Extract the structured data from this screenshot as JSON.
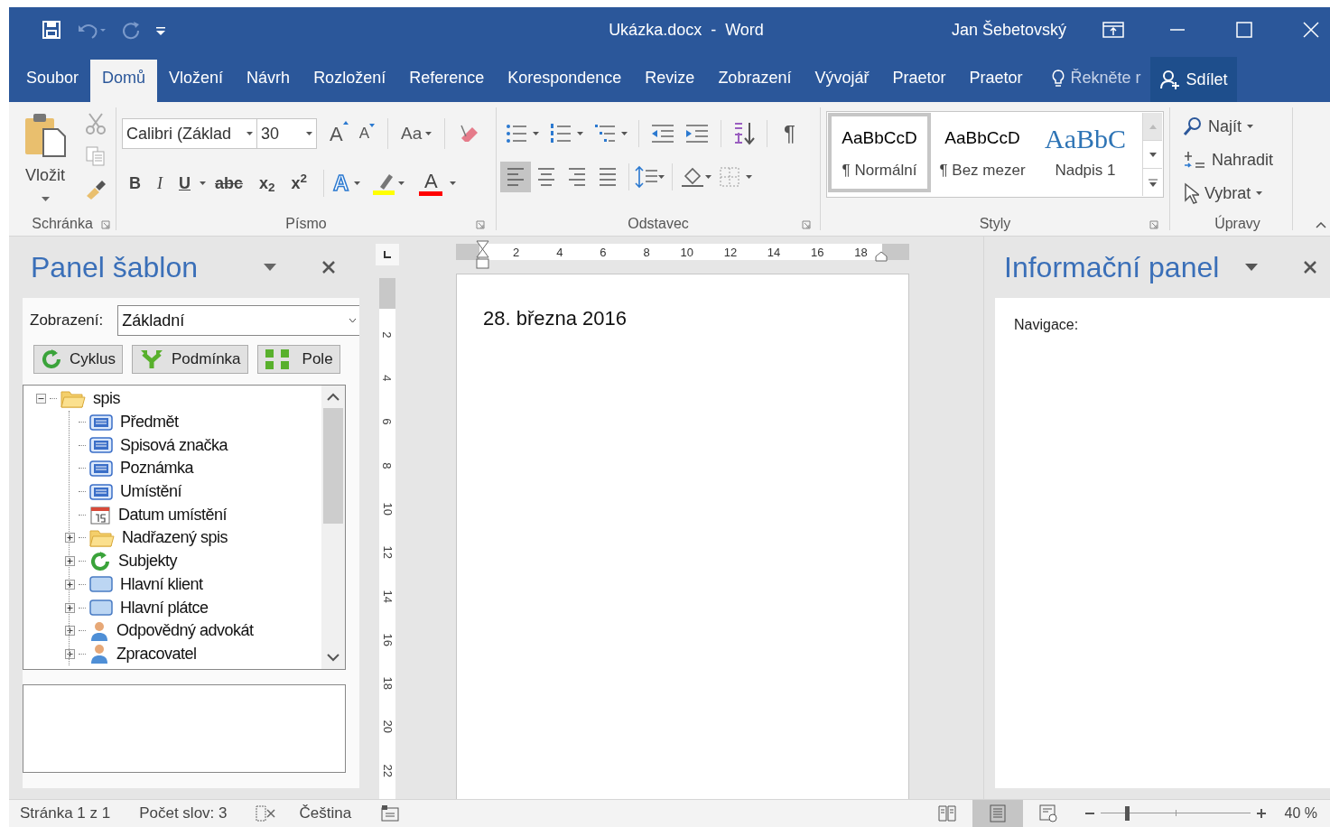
{
  "window": {
    "title": "Ukázka.docx  -  Word",
    "user": "Jan Šebetovský"
  },
  "tabs": [
    {
      "label": "Soubor",
      "selected": false
    },
    {
      "label": "Domů",
      "selected": true
    },
    {
      "label": "Vložení",
      "selected": false
    },
    {
      "label": "Návrh",
      "selected": false
    },
    {
      "label": "Rozložení",
      "selected": false
    },
    {
      "label": "Reference",
      "selected": false
    },
    {
      "label": "Korespondence",
      "selected": false
    },
    {
      "label": "Revize",
      "selected": false
    },
    {
      "label": "Zobrazení",
      "selected": false
    },
    {
      "label": "Vývojář",
      "selected": false
    },
    {
      "label": "Praetor",
      "selected": false
    },
    {
      "label": "Praetor",
      "selected": false
    }
  ],
  "tell_me": "Řekněte r",
  "share": "Sdílet",
  "ribbon": {
    "clipboard": {
      "paste": "Vložit",
      "label": "Schránka"
    },
    "font": {
      "family": "Calibri (Základ",
      "size": "30",
      "grow": "A",
      "shrink": "A",
      "change_case": "Aa",
      "formats": [
        {
          "label": "B",
          "kind": "bold"
        },
        {
          "label": "I",
          "kind": "italic"
        },
        {
          "label": "U",
          "kind": "underline"
        },
        {
          "label": "abc",
          "kind": "strike"
        },
        {
          "label": "x$_{2}$",
          "kind": "sub"
        },
        {
          "label": "x$^{2}$",
          "kind": "sup"
        }
      ],
      "text_effects": "A",
      "font_color": "A",
      "label": "Písmo"
    },
    "paragraph": {
      "show_marks": "¶",
      "alignments": [
        {
          "selected": true
        },
        {
          "selected": false
        },
        {
          "selected": false
        },
        {
          "selected": false
        }
      ],
      "label": "Odstavec"
    },
    "styles": {
      "items": [
        {
          "preview": "AaBbCcD",
          "name": "¶ Normální",
          "selected": true,
          "kind": "normal"
        },
        {
          "preview": "AaBbCcD",
          "name": "¶ Bez mezer",
          "selected": false,
          "kind": "normal"
        },
        {
          "preview": "AaBbC",
          "name": "Nadpis 1",
          "selected": false,
          "kind": "heading"
        }
      ],
      "label": "Styly"
    },
    "editing": {
      "items": [
        {
          "label": "Najít",
          "kind": "find"
        },
        {
          "label": "Nahradit",
          "kind": "replace"
        },
        {
          "label": "Vybrat",
          "kind": "select"
        }
      ],
      "label": "Úpravy"
    }
  },
  "template_panel": {
    "title": "Panel šablon",
    "view_label": "Zobrazení:",
    "view_value": "Základní",
    "buttons": [
      {
        "label": "Cyklus",
        "kind": "cycle"
      },
      {
        "label": "Podmínka",
        "kind": "condition"
      },
      {
        "label": "Pole",
        "kind": "field"
      }
    ],
    "tree": [
      {
        "label": "spis",
        "kind": "folder",
        "expanded": true,
        "children": [
          {
            "label": "Předmět",
            "kind": "text"
          },
          {
            "label": "Spisová značka",
            "kind": "text"
          },
          {
            "label": "Poznámka",
            "kind": "text"
          },
          {
            "label": "Umístění",
            "kind": "text"
          },
          {
            "label": "Datum umístění",
            "kind": "date"
          },
          {
            "label": "Nadřazený spis",
            "kind": "folder",
            "expanded": false
          },
          {
            "label": "Subjekty",
            "kind": "cycle",
            "expanded": false
          },
          {
            "label": "Hlavní klient",
            "kind": "entity",
            "expanded": false
          },
          {
            "label": "Hlavní plátce",
            "kind": "entity",
            "expanded": false
          },
          {
            "label": "Odpovědný advokát",
            "kind": "person",
            "expanded": false
          },
          {
            "label": "Zpracovatel",
            "kind": "person",
            "expanded": false
          }
        ]
      }
    ]
  },
  "rulers": {
    "horizontal": [
      "2",
      "4",
      "6",
      "8",
      "10",
      "12",
      "14",
      "16",
      "18"
    ],
    "vertical": [
      "2",
      "4",
      "6",
      "8",
      "10",
      "12",
      "14",
      "16",
      "18",
      "20",
      "22"
    ]
  },
  "document": {
    "text": "28. března 2016"
  },
  "info_panel": {
    "title": "Informační panel",
    "navigation_label": "Navigace:"
  },
  "status_bar": {
    "page": "Stránka 1 z 1",
    "words": "Počet slov: 3",
    "language": "Čeština",
    "views": [
      {
        "selected": false
      },
      {
        "selected": true
      },
      {
        "selected": false
      }
    ],
    "zoom": {
      "level": 0.18,
      "reading": "40 %"
    }
  }
}
